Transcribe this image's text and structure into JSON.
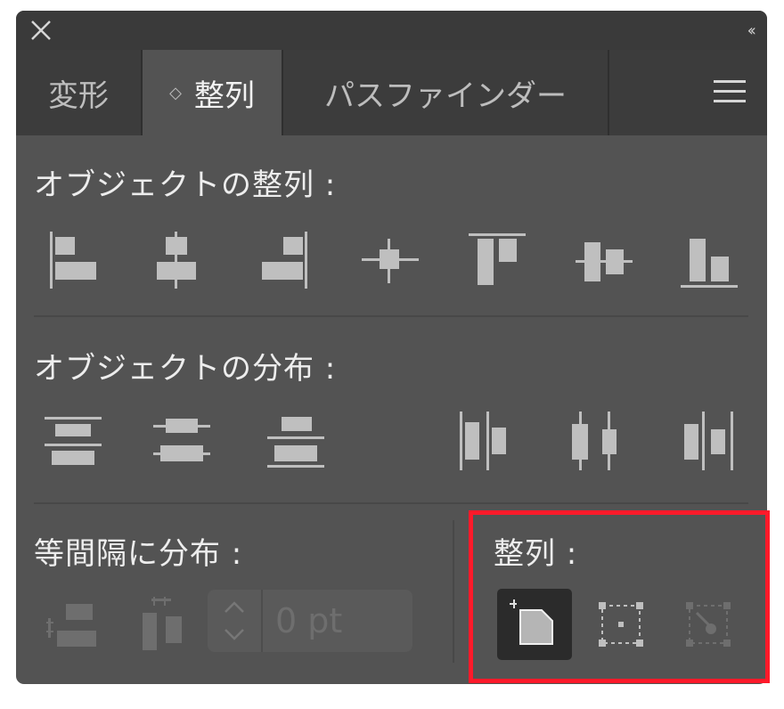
{
  "tabs": [
    {
      "label": "変形",
      "active": false
    },
    {
      "label": "整列",
      "active": true
    },
    {
      "label": "パスファインダー",
      "active": false
    }
  ],
  "align_objects": {
    "title": "オブジェクトの整列 :"
  },
  "distribute_objects": {
    "title": "オブジェクトの分布 :"
  },
  "distribute_spacing": {
    "title": "等間隔に分布 :",
    "value": "0 pt"
  },
  "align_to": {
    "title": "整列 :"
  },
  "colors": {
    "panel": "#535353",
    "titlebar": "#3a3a3a",
    "icon": "#bfbfbf",
    "highlight": "#ff1a2a"
  },
  "icons": [
    "close-icon",
    "collapse-icon",
    "menu-icon",
    "align-left-icon",
    "align-hcenter-icon",
    "align-right-icon",
    "align-vcenter-icon",
    "align-top-icon",
    "align-vcenter2-icon",
    "align-bottom-icon",
    "dist-top-icon",
    "dist-vcenter-icon",
    "dist-bottom-icon",
    "dist-left-icon",
    "dist-hcenter-icon",
    "dist-right-icon",
    "dist-vspace-icon",
    "dist-hspace-icon",
    "align-to-selection-icon",
    "align-to-artboard-icon",
    "align-to-key-object-icon"
  ]
}
